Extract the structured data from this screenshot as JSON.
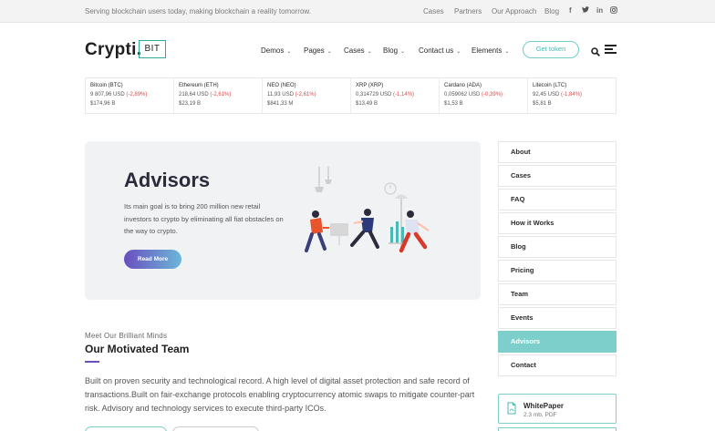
{
  "topbar": {
    "tagline": "Serving blockchain users today, making blockchain a reality tomorrow.",
    "links": [
      "Cases",
      "Partners",
      "Our Approach",
      "Blog"
    ],
    "social_icons": [
      "facebook-icon",
      "twitter-icon",
      "linkedin-icon",
      "instagram-icon"
    ]
  },
  "header": {
    "logo_text": "Crypti.",
    "logo_box": "BIT",
    "nav": [
      "Demos",
      "Pages",
      "Cases",
      "Blog",
      "Contact us",
      "Elements"
    ],
    "cta": "Get token"
  },
  "ticker": [
    {
      "name": "Bitcoin (BTC)",
      "price": "9 807,96 USD",
      "change": "(-2,89%)",
      "cap": "$174,96 B"
    },
    {
      "name": "Ethereum (ETH)",
      "price": "218,64 USD",
      "change": "(-2,61%)",
      "cap": "$23,19 B"
    },
    {
      "name": "NEO (NEO)",
      "price": "11,93 USD",
      "change": "(-2,61%)",
      "cap": "$841,33 M"
    },
    {
      "name": "XRP (XRP)",
      "price": "0,314729 USD",
      "change": "(-1,14%)",
      "cap": "$13,49 B"
    },
    {
      "name": "Cardano (ADA)",
      "price": "0,059062 USD",
      "change": "(-0,39%)",
      "cap": "$1,53 B"
    },
    {
      "name": "Litecoin (LTC)",
      "price": "92,45 USD",
      "change": "(-1,84%)",
      "cap": "$5,81 B"
    }
  ],
  "hero": {
    "title": "Advisors",
    "body": "Its main goal is to bring 200 million new retail investors to crypto by eliminating all fiat obstacles on the way to crypto.",
    "button": "Read More"
  },
  "team": {
    "eyebrow": "Meet Our Brilliant Minds",
    "title": "Our Motivated Team",
    "body": "Built on proven security and technological record. A high level of digital asset protection and safe record of transactions.Built on fair-exchange protocols enabling cryptocurrency atomic swaps to mitigate counter-part risk. Advisory and technology services to execute third-party ICOs."
  },
  "sidebar": {
    "items": [
      "About",
      "Cases",
      "FAQ",
      "How it Works",
      "Blog",
      "Pricing",
      "Team",
      "Events",
      "Advisors",
      "Contact"
    ],
    "active": "Advisors"
  },
  "whitepaper": {
    "title": "WhitePaper",
    "meta": "2.3 mb, PDF"
  },
  "colors": {
    "accent": "#7ccfcb",
    "negative": "#e04747",
    "purple": "#6a4fbf"
  }
}
